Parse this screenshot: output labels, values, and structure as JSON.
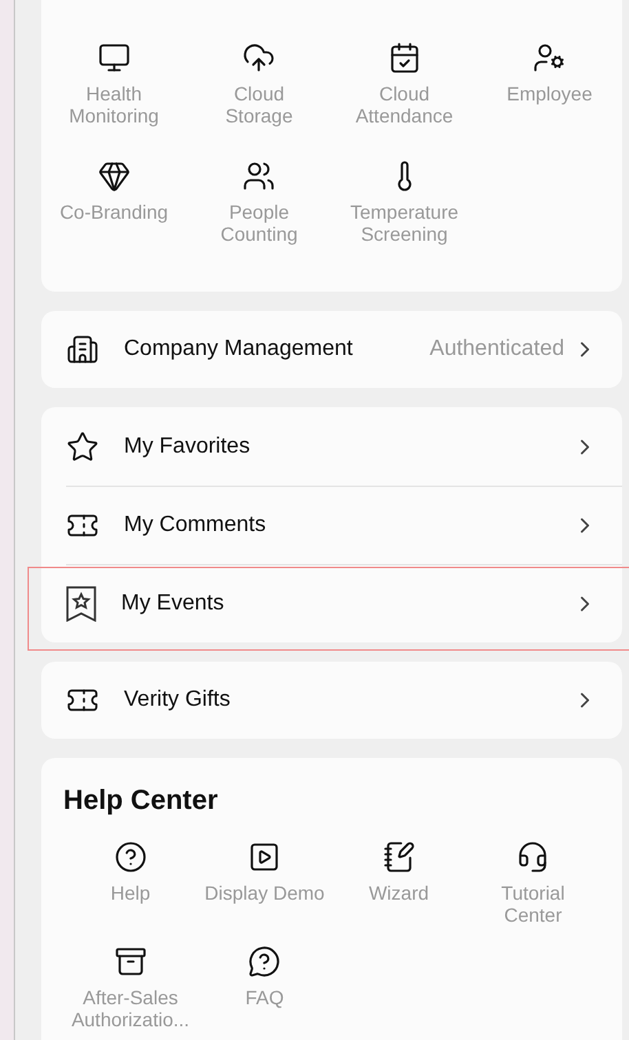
{
  "service_market": {
    "items": [
      {
        "label": "Health\nMonitoring"
      },
      {
        "label": "Cloud\nStorage"
      },
      {
        "label": "Cloud\nAttendance"
      },
      {
        "label": "Employee"
      },
      {
        "label": "Co-Branding"
      },
      {
        "label": "People\nCounting"
      },
      {
        "label": "Temperature\nScreening"
      }
    ]
  },
  "company": {
    "label": "Company Management",
    "value": "Authenticated"
  },
  "personal": {
    "items": [
      {
        "label": "My Favorites",
        "highlighted": false
      },
      {
        "label": "My Comments",
        "highlighted": false
      },
      {
        "label": "My Events",
        "highlighted": true
      }
    ]
  },
  "gifts": {
    "label": "Verity Gifts"
  },
  "help_center": {
    "title": "Help Center",
    "items": [
      {
        "label": "Help"
      },
      {
        "label": "Display Demo"
      },
      {
        "label": "Wizard"
      },
      {
        "label": "Tutorial\nCenter"
      },
      {
        "label": "After-Sales\nAuthorizatio..."
      },
      {
        "label": "FAQ"
      }
    ]
  }
}
